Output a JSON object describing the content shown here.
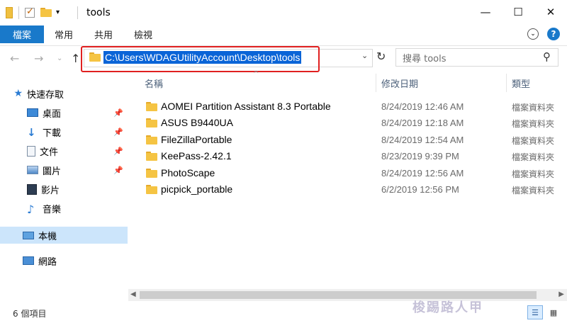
{
  "window": {
    "title": "tools",
    "controls": {
      "minimize": "—",
      "maximize": "☐",
      "close": "✕"
    }
  },
  "ribbon": {
    "tabs": [
      {
        "label": "檔案"
      },
      {
        "label": "常用"
      },
      {
        "label": "共用"
      },
      {
        "label": "檢視"
      }
    ]
  },
  "address": {
    "path": "C:\\Users\\WDAGUtilityAccount\\Desktop\\tools",
    "highlight_color": "#e02020"
  },
  "search": {
    "placeholder": "搜尋 tools"
  },
  "sidebar": {
    "items": [
      {
        "label": "快速存取",
        "icon": "star-icon"
      },
      {
        "label": "桌面",
        "icon": "desktop-icon",
        "pinned": true
      },
      {
        "label": "下載",
        "icon": "download-icon",
        "pinned": true
      },
      {
        "label": "文件",
        "icon": "document-icon",
        "pinned": true
      },
      {
        "label": "圖片",
        "icon": "pictures-icon",
        "pinned": true
      },
      {
        "label": "影片",
        "icon": "videos-icon"
      },
      {
        "label": "音樂",
        "icon": "music-icon"
      },
      {
        "label": "本機",
        "icon": "this-pc-icon",
        "selected": true
      },
      {
        "label": "網路",
        "icon": "network-icon"
      }
    ]
  },
  "columns": {
    "name": "名稱",
    "modified": "修改日期",
    "type": "類型"
  },
  "files": [
    {
      "name": "AOMEI Partition Assistant 8.3 Portable",
      "modified": "8/24/2019 12:46 AM",
      "type": "檔案資料夾"
    },
    {
      "name": "ASUS B9440UA",
      "modified": "8/24/2019 12:18 AM",
      "type": "檔案資料夾"
    },
    {
      "name": "FileZillaPortable",
      "modified": "8/24/2019 12:54 AM",
      "type": "檔案資料夾"
    },
    {
      "name": "KeePass-2.42.1",
      "modified": "8/23/2019 9:39 PM",
      "type": "檔案資料夾"
    },
    {
      "name": "PhotoScape",
      "modified": "8/24/2019 12:56 AM",
      "type": "檔案資料夾"
    },
    {
      "name": "picpick_portable",
      "modified": "6/2/2019 12:56 PM",
      "type": "檔案資料夾"
    }
  ],
  "status": {
    "item_count": "6 個項目"
  },
  "watermark": "梭踢路人甲",
  "colors": {
    "accent": "#1979ca",
    "selection": "#0a64d7",
    "nav_selected": "#cce5fb",
    "folder": "#f5c443"
  }
}
